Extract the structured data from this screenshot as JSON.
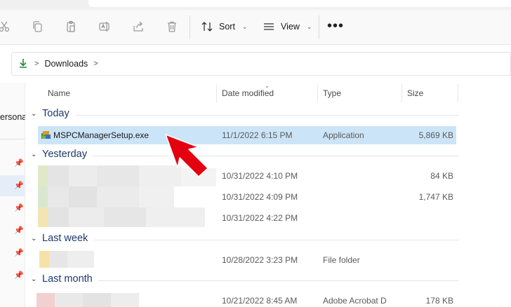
{
  "toolbar": {
    "sort_label": "Sort",
    "view_label": "View",
    "more_label": "•••"
  },
  "address": {
    "crumbs": [
      "Downloads"
    ]
  },
  "navpane": {
    "partial_label": "ersona"
  },
  "columns": {
    "name": "Name",
    "date": "Date modified",
    "type": "Type",
    "size": "Size"
  },
  "groups": {
    "today": "Today",
    "yesterday": "Yesterday",
    "last_week": "Last week",
    "last_month": "Last month"
  },
  "rows": [
    {
      "name": "MSPCManagerSetup.exe",
      "date": "11/1/2022 6:15 PM",
      "type": "Application",
      "size": "5,869 KB"
    },
    {
      "name": "",
      "date": "10/31/2022 4:10 PM",
      "type": "",
      "size": "84 KB"
    },
    {
      "name": "",
      "date": "10/31/2022 4:09 PM",
      "type": "",
      "size": "1,747 KB"
    },
    {
      "name": "",
      "date": "10/31/2022 4:22 PM",
      "type": "",
      "size": ""
    },
    {
      "name": "",
      "date": "10/28/2022 3:23 PM",
      "type": "File folder",
      "size": ""
    },
    {
      "name": "",
      "date": "10/21/2022 8:45 AM",
      "type": "Adobe Acrobat D",
      "size": "178 KB"
    }
  ],
  "colors": {
    "selected_row": "#cce4f7",
    "group_text": "#1d3a6e",
    "accent": "#0067c0",
    "arrow": "#e3000f"
  }
}
